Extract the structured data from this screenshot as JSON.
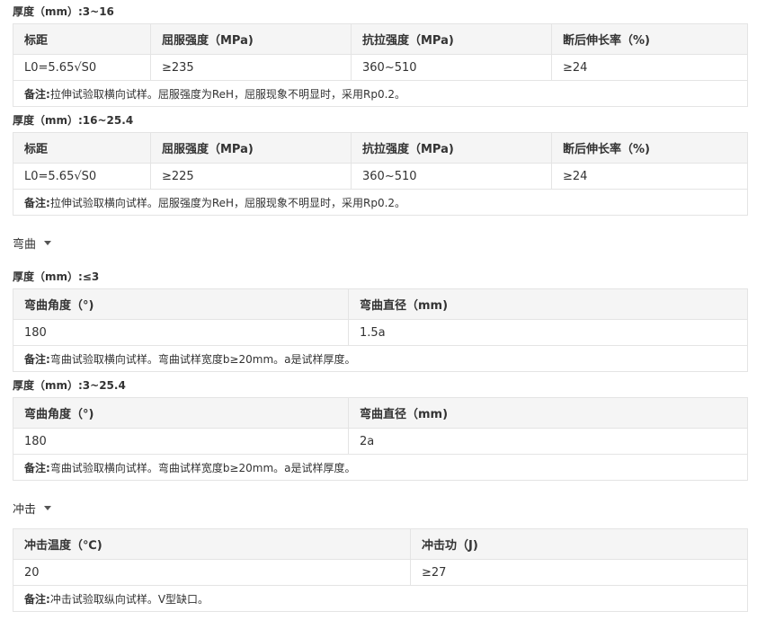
{
  "tensile": {
    "group1": {
      "title": "厚度（mm）:3~16",
      "headers": [
        "标距",
        "屈服强度（MPa)",
        "抗拉强度（MPa)",
        "断后伸长率（%)"
      ],
      "row": [
        "L0=5.65√S0",
        "≥235",
        "360~510",
        "≥24"
      ],
      "note_label": "备注:",
      "note": "拉伸试验取横向试样。屈服强度为ReH，屈服现象不明显时，采用Rp0.2。"
    },
    "group2": {
      "title": "厚度（mm）:16~25.4",
      "headers": [
        "标距",
        "屈服强度（MPa)",
        "抗拉强度（MPa)",
        "断后伸长率（%)"
      ],
      "row": [
        "L0=5.65√S0",
        "≥225",
        "360~510",
        "≥24"
      ],
      "note_label": "备注:",
      "note": "拉伸试验取横向试样。屈服强度为ReH，屈服现象不明显时，采用Rp0.2。"
    }
  },
  "bend": {
    "section_label": "弯曲",
    "group1": {
      "title": "厚度（mm）:≤3",
      "headers": [
        "弯曲角度（°)",
        "弯曲直径（mm)"
      ],
      "row": [
        "180",
        "1.5a"
      ],
      "note_label": "备注:",
      "note": "弯曲试验取横向试样。弯曲试样宽度b≥20mm。a是试样厚度。"
    },
    "group2": {
      "title": "厚度（mm）:3~25.4",
      "headers": [
        "弯曲角度（°)",
        "弯曲直径（mm)"
      ],
      "row": [
        "180",
        "2a"
      ],
      "note_label": "备注:",
      "note": "弯曲试验取横向试样。弯曲试样宽度b≥20mm。a是试样厚度。"
    }
  },
  "impact": {
    "section_label": "冲击",
    "headers": [
      "冲击温度（℃)",
      "冲击功（J)"
    ],
    "row": [
      "20",
      "≥27"
    ],
    "note_label": "备注:",
    "note": "冲击试验取纵向试样。V型缺口。"
  }
}
